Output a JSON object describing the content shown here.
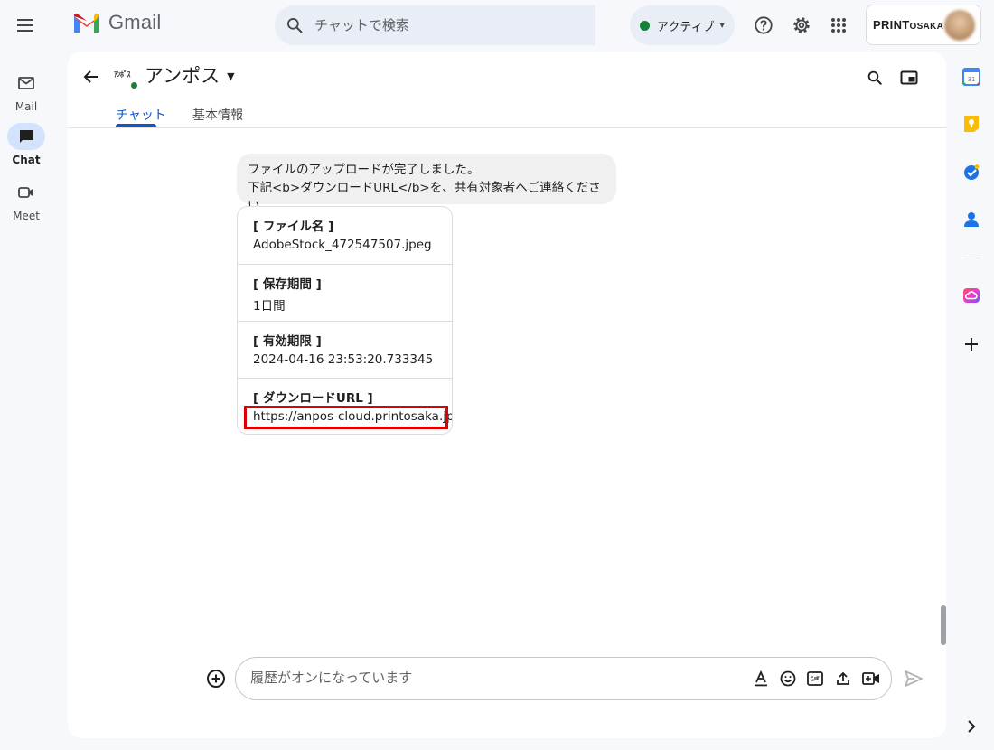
{
  "topbar": {
    "app_name": "Gmail",
    "search_placeholder": "チャットで検索",
    "status_label": "アクティブ",
    "brand": "PRINT",
    "brand_sub": "OSAKA"
  },
  "rail": {
    "items": [
      {
        "label": "Mail",
        "icon": "mail-icon"
      },
      {
        "label": "Chat",
        "icon": "chat-icon",
        "active": true
      },
      {
        "label": "Meet",
        "icon": "video-icon"
      }
    ]
  },
  "space": {
    "name": "アンポス",
    "avatar_text": "ｱﾝﾎﾟｽ",
    "tabs": [
      "チャット",
      "基本情報"
    ]
  },
  "message": {
    "line1": "ファイルのアップロードが完了しました。",
    "line2": "下記<b>ダウンロードURL</b>を、共有対象者へご連絡ください。"
  },
  "card": {
    "sections": [
      {
        "title": "[ ファイル名 ]",
        "value": "AdobeStock_472547507.jpeg"
      },
      {
        "title": "[ 保存期間 ]",
        "value": "1日間"
      },
      {
        "title": "[ 有効期限 ]",
        "value": "2024-04-16 23:53:20.733345"
      },
      {
        "title": "[ ダウンロードURL ]",
        "value": "https://anpos-cloud.printosaka.jp/"
      }
    ]
  },
  "compose": {
    "placeholder": "履歴がオンになっています"
  },
  "colors": {
    "accent": "#0b57d0",
    "active_green": "#188038",
    "highlight_red": "#e00000"
  }
}
